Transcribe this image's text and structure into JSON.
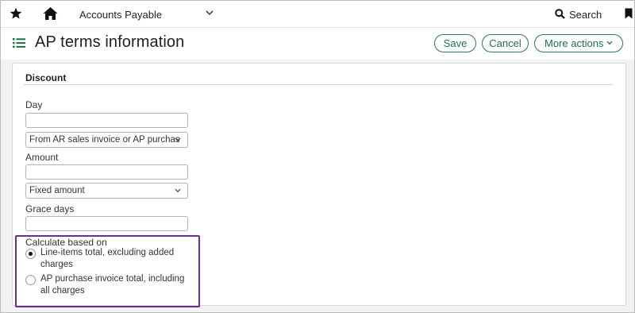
{
  "topbar": {
    "module": "Accounts Payable",
    "search_label": "Search"
  },
  "header": {
    "title": "AP terms information",
    "save_label": "Save",
    "cancel_label": "Cancel",
    "more_actions_label": "More actions"
  },
  "discount": {
    "section_title": "Discount",
    "day_label": "Day",
    "day_value": "",
    "day_basis_selected": "From AR sales invoice or AP purchas",
    "amount_label": "Amount",
    "amount_value": "",
    "amount_type_selected": "Fixed amount",
    "grace_days_label": "Grace days",
    "grace_days_value": "",
    "calc_label": "Calculate based on",
    "options": [
      {
        "label": "Line-items total, excluding added charges",
        "checked": true
      },
      {
        "label": "AP purchase invoice total, including all charges",
        "checked": false
      }
    ]
  },
  "colors": {
    "accent": "#1f6e4a",
    "highlight": "#6a2e8c"
  },
  "icons": [
    "star-icon",
    "home-icon",
    "chevron-down-icon",
    "search-icon",
    "bookmark-icon",
    "list-icon"
  ]
}
